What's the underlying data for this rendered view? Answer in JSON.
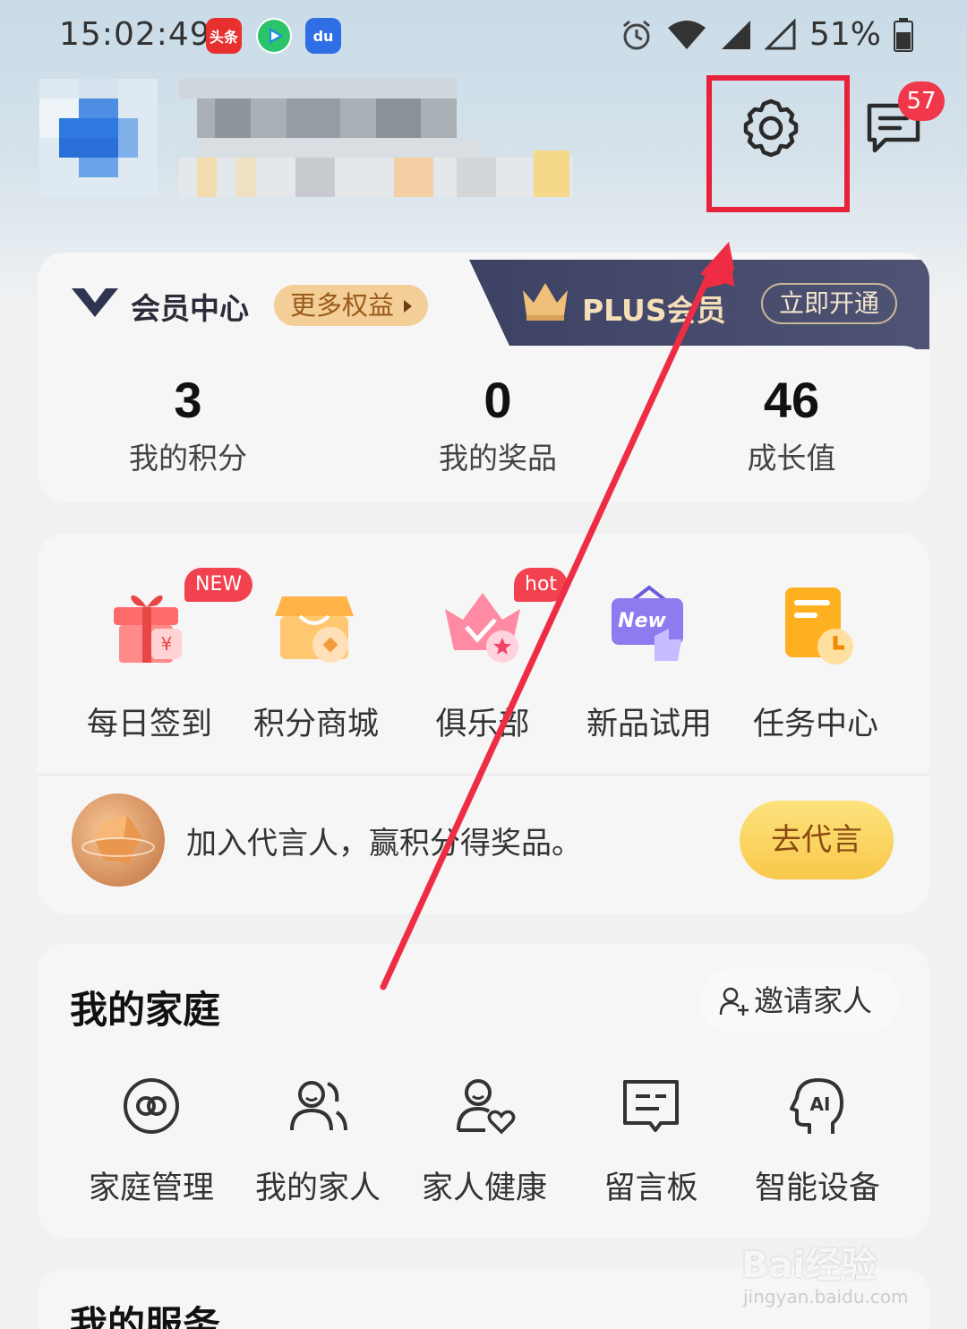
{
  "status_bar": {
    "time": "15:02:49",
    "battery": "51%",
    "app_icons": [
      "toutiao-icon",
      "video-player-icon",
      "baidu-icon"
    ],
    "app_icon_labels": {
      "toutiao": "头条",
      "baidu": "du"
    }
  },
  "header": {
    "message_badge": "57",
    "icons": [
      "settings-icon",
      "message-icon"
    ]
  },
  "member": {
    "title": "会员中心",
    "more_label": "更多权益",
    "plus_title": "PLUS会员",
    "open_label": "立即开通",
    "stats": [
      {
        "value": "3",
        "label": "我的积分"
      },
      {
        "value": "0",
        "label": "我的奖品"
      },
      {
        "value": "46",
        "label": "成长值"
      }
    ]
  },
  "features": {
    "items": [
      {
        "label": "每日签到",
        "tag": "NEW",
        "icon": "gift-icon"
      },
      {
        "label": "积分商城",
        "tag": "",
        "icon": "shop-icon"
      },
      {
        "label": "俱乐部",
        "tag": "hot",
        "icon": "crown-icon"
      },
      {
        "label": "新品试用",
        "tag": "",
        "icon": "new-product-icon",
        "icon_text": "New"
      },
      {
        "label": "任务中心",
        "tag": "",
        "icon": "task-icon"
      }
    ],
    "ambassador_text": "加入代言人，赢积分得奖品。",
    "ambassador_button": "去代言"
  },
  "family": {
    "title": "我的家庭",
    "invite_label": "邀请家人",
    "items": [
      {
        "label": "家庭管理",
        "icon": "link-icon"
      },
      {
        "label": "我的家人",
        "icon": "people-icon"
      },
      {
        "label": "家人健康",
        "icon": "health-icon"
      },
      {
        "label": "留言板",
        "icon": "message-board-icon"
      },
      {
        "label": "智能设备",
        "icon": "ai-device-icon",
        "icon_text": "AI"
      }
    ]
  },
  "services": {
    "title": "我的服务"
  },
  "watermark": {
    "text": "Bai经验",
    "sub": "jingyan.baidu.com"
  },
  "colors": {
    "highlight": "#e8213b",
    "badge": "#f0384a",
    "plus_band": "#3d4163",
    "cta": "#f8c84a"
  }
}
